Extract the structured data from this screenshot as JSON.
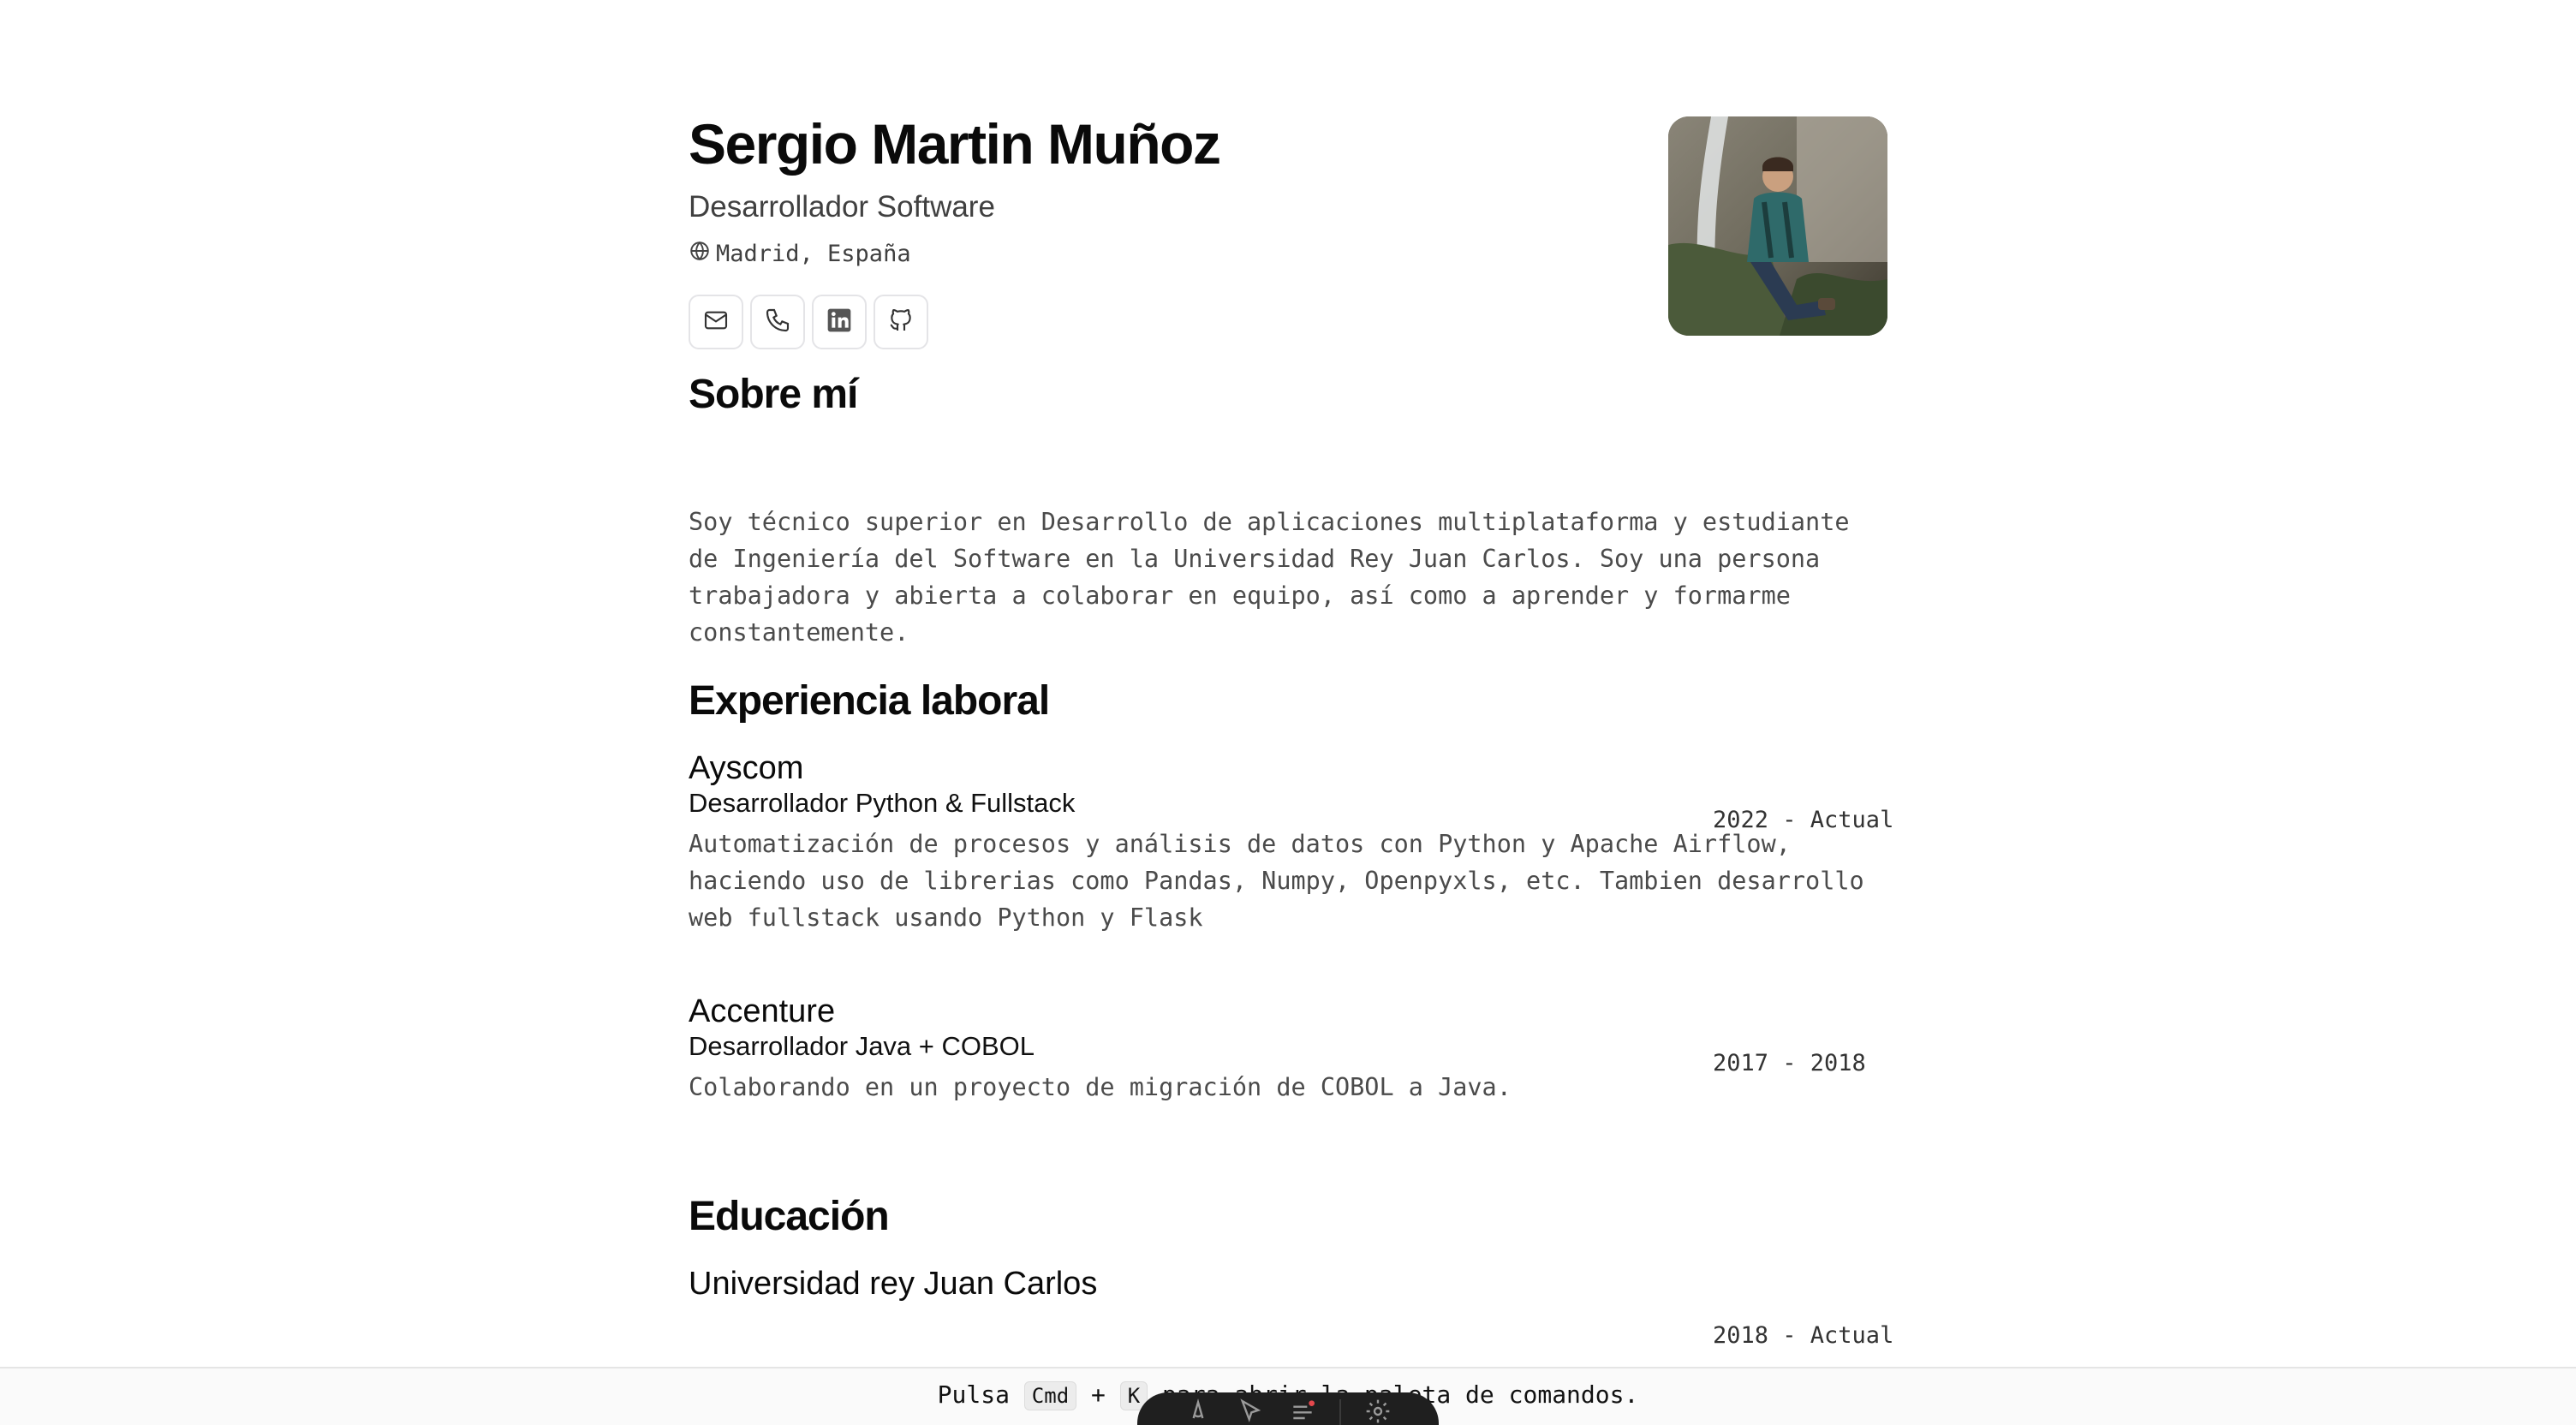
{
  "header": {
    "name": "Sergio Martin Muñoz",
    "role": "Desarrollador Software",
    "location": "Madrid, España"
  },
  "contacts": [
    {
      "icon": "mail-icon"
    },
    {
      "icon": "phone-icon"
    },
    {
      "icon": "linkedin-icon"
    },
    {
      "icon": "github-icon"
    }
  ],
  "about": {
    "title": "Sobre mí",
    "text": "Soy técnico superior en Desarrollo de aplicaciones multiplataforma y estudiante de Ingeniería del Software en la Universidad Rey Juan Carlos. Soy una persona trabajadora y abierta a colaborar en equipo, así como a aprender y formarme constantemente."
  },
  "experience": {
    "title": "Experiencia laboral",
    "jobs": [
      {
        "company": "Ayscom",
        "title": "Desarrollador Python & Fullstack",
        "date": "2022 - Actual",
        "description": "Automatización de procesos y análisis de datos con Python y Apache Airflow, haciendo uso de librerias como Pandas, Numpy, Openpyxls, etc. Tambien desarrollo web fullstack usando Python y Flask"
      },
      {
        "company": "Accenture",
        "title": "Desarrollador Java + COBOL",
        "date": "2017 - 2018",
        "description": "Colaborando en un proyecto de migración de COBOL a Java."
      }
    ]
  },
  "education": {
    "title": "Educación",
    "items": [
      {
        "school": "Universidad rey Juan Carlos",
        "date": "2018 - Actual"
      }
    ]
  },
  "footer": {
    "prefix": "Pulsa",
    "key1": "Cmd",
    "plus": "+",
    "key2": "K",
    "suffix": "para abrir la paleta de comandos."
  },
  "colors": {
    "text": "#0a0a0a",
    "muted": "#4b4b4b",
    "border": "#e4e4e7",
    "dock": "#1f1f1f"
  }
}
